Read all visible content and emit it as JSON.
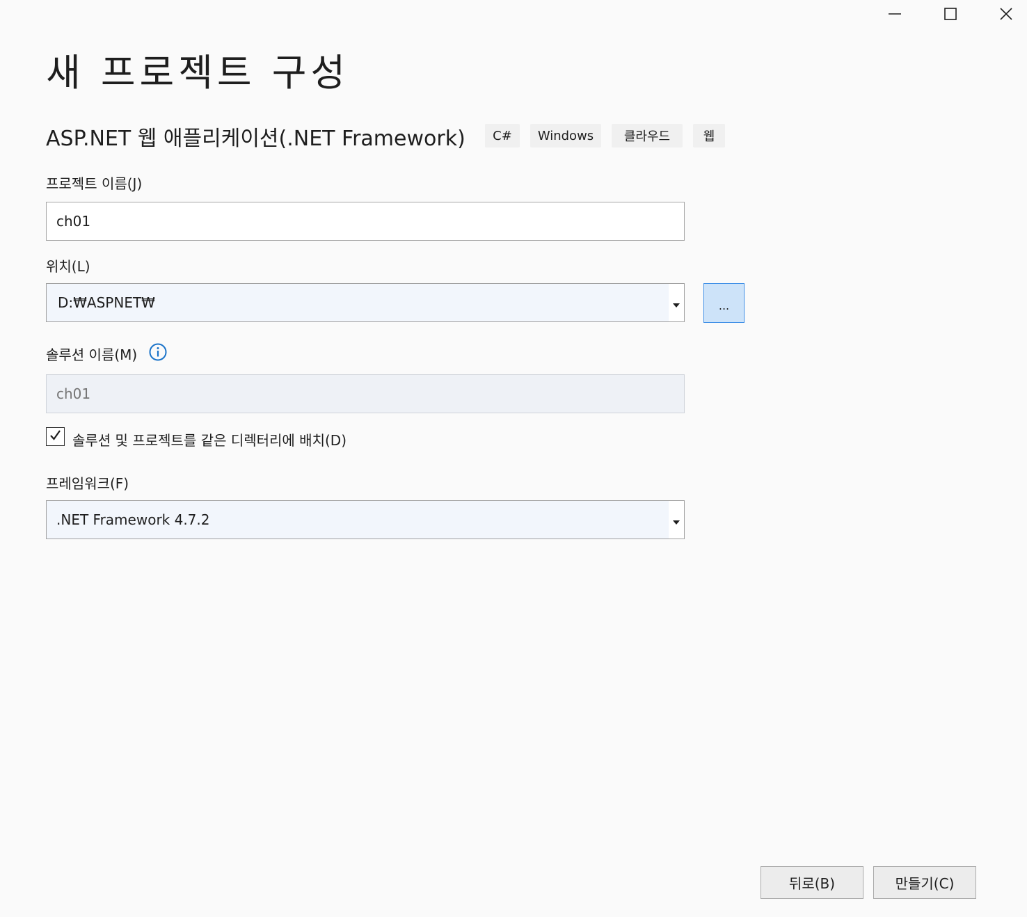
{
  "window": {
    "minimize_icon": "minimize-icon",
    "maximize_icon": "maximize-icon",
    "close_icon": "close-icon"
  },
  "header": {
    "title": "새 프로젝트 구성",
    "template_name": "ASP.NET 웹 애플리케이션(.NET Framework)",
    "tags": [
      "C#",
      "Windows",
      "클라우드",
      "웹"
    ]
  },
  "form": {
    "project_name": {
      "label": "프로젝트 이름(J)",
      "value": "ch01"
    },
    "location": {
      "label": "위치(L)",
      "value": "D:₩ASPNET₩",
      "browse_label": "..."
    },
    "solution_name": {
      "label": "솔루션 이름(M)",
      "placeholder": "ch01",
      "info_icon": "info-icon"
    },
    "same_directory": {
      "label": "솔루션 및 프로젝트를 같은 디렉터리에 배치(D)",
      "checked": true
    },
    "framework": {
      "label": "프레임워크(F)",
      "value": ".NET Framework 4.7.2"
    }
  },
  "footer": {
    "back_label": "뒤로(B)",
    "create_label": "만들기(C)"
  },
  "colors": {
    "background": "#fafafa",
    "accent": "#3d8ee6",
    "info_blue": "#1a73c9"
  }
}
